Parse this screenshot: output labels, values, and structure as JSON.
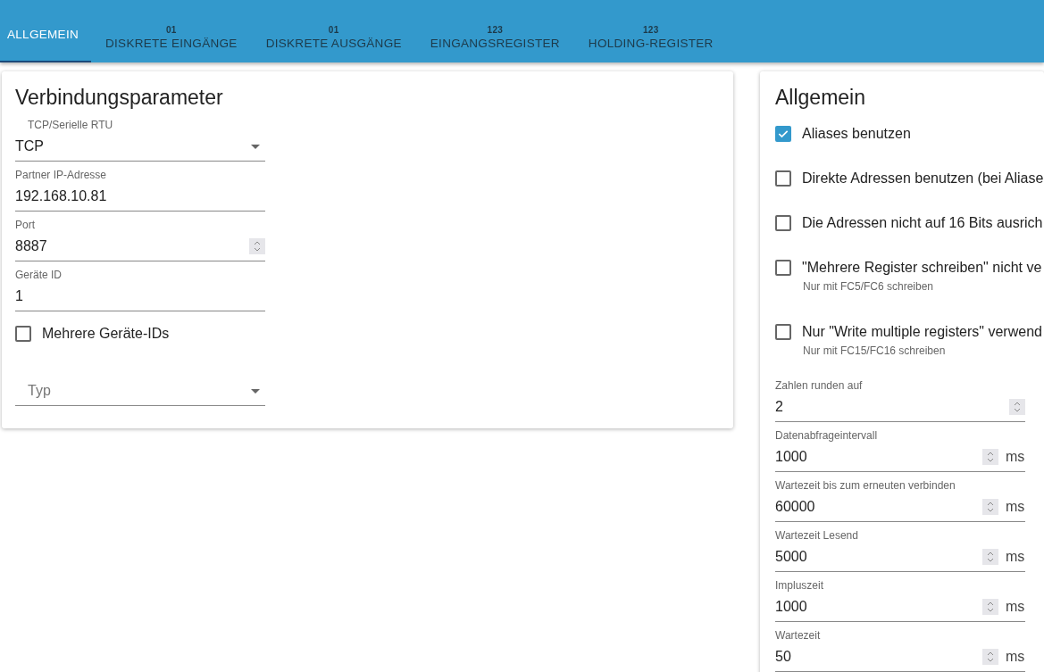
{
  "tabs": [
    {
      "label": "ALLGEMEIN",
      "selected": true
    },
    {
      "badge": "01",
      "label": "DISKRETE EINGÄNGE",
      "selected": false
    },
    {
      "badge": "01",
      "label": "DISKRETE AUSGÄNGE",
      "selected": false
    },
    {
      "badge": "123",
      "label": "EINGANGSREGISTER",
      "selected": false
    },
    {
      "badge": "123",
      "label": "HOLDING-REGISTER",
      "selected": false
    }
  ],
  "connection": {
    "title": "Verbindungsparameter",
    "fields": [
      {
        "kind": "select",
        "label": "TCP/Serielle RTU",
        "value": "TCP"
      },
      {
        "kind": "text",
        "label": "Partner IP-Adresse",
        "value": "192.168.10.81"
      },
      {
        "kind": "number",
        "label": "Port",
        "value": "8887"
      },
      {
        "kind": "text",
        "label": "Geräte ID",
        "value": "1"
      },
      {
        "kind": "checkbox",
        "label": "Mehrere Geräte-IDs",
        "checked": false
      },
      {
        "kind": "select",
        "placeholder": "Typ"
      }
    ]
  },
  "general": {
    "title": "Allgemein",
    "options": [
      {
        "label": "Aliases benutzen",
        "checked": true
      },
      {
        "label": "Direkte Adressen benutzen (bei Aliase",
        "checked": false
      },
      {
        "label": "Die Adressen nicht auf 16 Bits ausrich",
        "checked": false
      },
      {
        "label": "\"Mehrere Register schreiben\" nicht ve",
        "hint": "Nur mit FC5/FC6 schreiben",
        "checked": false
      },
      {
        "label": "Nur \"Write multiple registers\" verwend",
        "hint": "Nur mit FC15/FC16 schreiben",
        "checked": false
      }
    ],
    "fields": [
      {
        "label": "Zahlen runden auf",
        "value": "2"
      },
      {
        "label": "Datenabfrageintervall",
        "value": "1000",
        "unit": "ms"
      },
      {
        "label": "Wartezeit bis zum erneuten verbinden",
        "value": "60000",
        "unit": "ms"
      },
      {
        "label": "Wartezeit Lesend",
        "value": "5000",
        "unit": "ms"
      },
      {
        "label": "Impluszeit",
        "value": "1000",
        "unit": "ms"
      },
      {
        "label": "Wartezeit",
        "value": "50",
        "unit": "ms"
      }
    ]
  }
}
